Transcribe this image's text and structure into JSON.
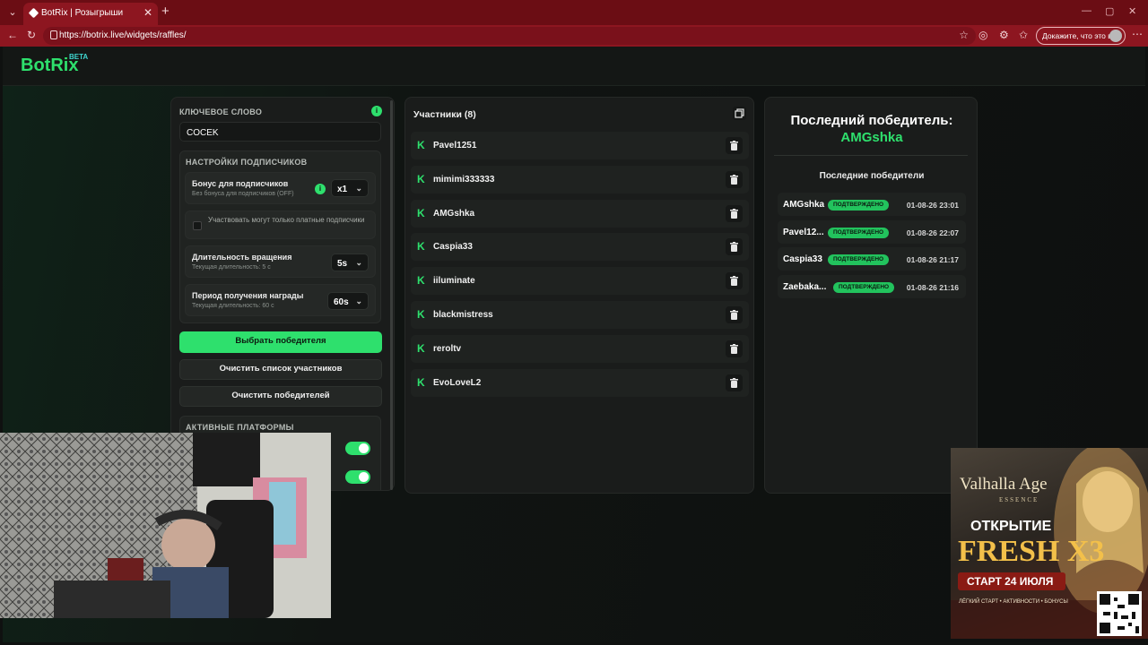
{
  "browser": {
    "tab_title": "BotRix | Розыгрыши",
    "url": "https://botrix.live/widgets/raffles/",
    "profile_label": "Докажите, что это вы"
  },
  "app": {
    "logo": "BotRix",
    "logo_badge": "BETA"
  },
  "settings": {
    "keyword_label": "КЛЮЧЕВОЕ СЛОВО",
    "keyword_value": "COCEK",
    "subscriber_section": "НАСТРОЙКИ ПОДПИСЧИКОВ",
    "bonus_title": "Бонус для подписчиков",
    "bonus_sub": "Без бонуса для подписчиков (OFF)",
    "bonus_value": "x1",
    "paid_only_label": "Участвовать могут только платные подписчики",
    "spin_title": "Длительность вращения",
    "spin_sub": "Текущая длительность: 5 с",
    "spin_value": "5s",
    "reward_title": "Период получения награды",
    "reward_sub": "Текущая длительность: 60 с",
    "reward_value": "60s",
    "pick_winner": "Выбрать победителя",
    "clear_participants": "Очистить список участников",
    "clear_winners": "Очистить победителей",
    "platforms_section": "АКТИВНЫЕ ПЛАТФОРМЫ"
  },
  "participants": {
    "title": "Участники (8)",
    "items": [
      "Pavel1251",
      "mimimi333333",
      "AMGshka",
      "Caspia33",
      "iiluminate",
      "blackmistress",
      "reroltv",
      "EvoLoveL2"
    ]
  },
  "winners": {
    "last_title": "Последний победитель:",
    "last_name": "AMGshka",
    "recent_title": "Последние победители",
    "items": [
      {
        "name": "AMGshka",
        "status": "ПОДТВЕРЖДЕНО",
        "date": "01-08-26 23:01"
      },
      {
        "name": "Pavel12...",
        "status": "ПОДТВЕРЖДЕНО",
        "date": "01-08-26 22:07"
      },
      {
        "name": "Caspia33",
        "status": "ПОДТВЕРЖДЕНО",
        "date": "01-08-26 21:17"
      },
      {
        "name": "Zaebaka...",
        "status": "ПОДТВЕРЖДЕНО",
        "date": "01-08-26 21:16"
      }
    ]
  },
  "ad": {
    "brand": "Valhalla Age",
    "brand_sub": "ESSENCE",
    "line1": "ОТКРЫТИЕ",
    "line2": "FRESH X3",
    "line3": "СТАРТ 24 ИЮЛЯ",
    "line4": "ЛЁГКИЙ СТАРТ • АКТИВНОСТИ • БОНУСЫ"
  },
  "colors": {
    "accent": "#2ee06d",
    "browser_frame": "#8d1620"
  }
}
